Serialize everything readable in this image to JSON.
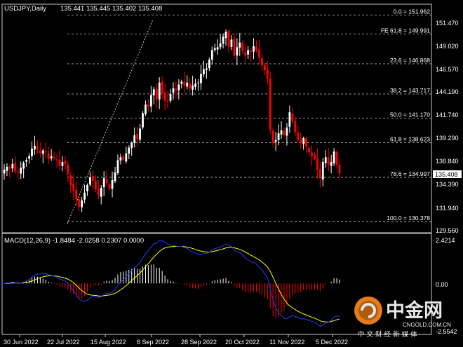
{
  "header": {
    "symbol": "USDJPY,Daily",
    "ohlc": "135.441 135.445 135.402 135.408"
  },
  "price_axis": {
    "labels": [
      "151.470",
      "149.020",
      "146.570",
      "144.190",
      "141.740",
      "139.290",
      "136.840",
      "134.390",
      "131.940",
      "129.560"
    ],
    "current_price": "135.408"
  },
  "fibonacci": {
    "levels": [
      {
        "label": "0.0 = 151.962",
        "price": 151.962
      },
      {
        "label": "FE 61.8 = 149.991",
        "price": 149.991
      },
      {
        "label": "23.6 = 146.868",
        "price": 146.868
      },
      {
        "label": "38.2 = 143.717",
        "price": 143.717
      },
      {
        "label": "50.0 = 141.170",
        "price": 141.17
      },
      {
        "label": "61.8 = 138.623",
        "price": 138.623
      },
      {
        "label": "78.6 = 134.997",
        "price": 134.997
      },
      {
        "label": "100.0 = 130.378",
        "price": 130.378
      }
    ]
  },
  "macd": {
    "title": "MACD(12,26,9) -1.8484 -2.0258 0.2307 0.0000",
    "axis_labels": [
      "2.4214",
      "0.00",
      "-2.5542"
    ]
  },
  "time_axis": {
    "labels": [
      "30 Jun 2022",
      "22 Jul 2022",
      "15 Aug 2022",
      "6 Sep 2022",
      "28 Sep 2022",
      "20 Oct 2022",
      "11 Nov 2022",
      "5 Dec 2022"
    ]
  },
  "watermark": {
    "brand": "中金网",
    "slogan": "中 文 财 经 新 媒 体",
    "url": "CNGOLD.COM.CN"
  },
  "colors": {
    "background": "#000000",
    "bull_candle": "#ffffff",
    "bear_candle": "#ff0000",
    "grid": "#c8c8c8",
    "macd_line": "#1f3dff",
    "signal_line": "#ffff00",
    "watermark_orange": "#ff8a1a"
  },
  "chart_data": {
    "type": "candlestick",
    "symbol": "USDJPY",
    "timeframe": "Daily",
    "y_range": [
      129.2,
      153.1
    ],
    "x_labels": [
      "30 Jun 2022",
      "22 Jul 2022",
      "15 Aug 2022",
      "6 Sep 2022",
      "28 Sep 2022",
      "20 Oct 2022",
      "11 Nov 2022",
      "5 Dec 2022"
    ],
    "close_path": [
      135.8,
      136.1,
      135.9,
      136.4,
      135.6,
      135.5,
      136.0,
      136.5,
      136.8,
      137.2,
      138.0,
      138.3,
      137.9,
      137.5,
      137.8,
      137.6,
      136.9,
      137.2,
      137.0,
      136.8,
      136.2,
      136.6,
      136.4,
      135.3,
      134.2,
      133.6,
      132.7,
      131.9,
      132.6,
      133.4,
      134.2,
      135.0,
      134.6,
      133.7,
      133.1,
      133.9,
      134.9,
      134.4,
      133.8,
      134.7,
      135.5,
      136.8,
      137.1,
      136.8,
      137.5,
      138.1,
      138.6,
      139.4,
      139.0,
      140.1,
      141.7,
      142.6,
      142.4,
      143.6,
      144.2,
      143.1,
      144.9,
      143.8,
      143.0,
      142.9,
      143.7,
      144.3,
      144.1,
      144.7,
      145.0,
      144.6,
      144.9,
      144.3,
      144.6,
      144.8,
      144.9,
      145.8,
      146.3,
      146.4,
      147.3,
      148.3,
      148.5,
      148.6,
      149.0,
      149.7,
      150.2,
      148.7,
      149.4,
      147.7,
      148.6,
      149.1,
      148.2,
      147.7,
      148.3,
      148.1,
      148.7,
      148.3,
      147.5,
      146.7,
      146.2,
      145.3,
      140.0,
      138.6,
      138.9,
      139.6,
      139.9,
      139.4,
      140.2,
      141.8,
      140.9,
      139.7,
      138.9,
      138.6,
      139.1,
      138.2,
      137.6,
      137.2,
      136.9,
      135.8,
      134.9,
      136.6,
      137.1,
      136.3,
      136.6,
      137.7,
      136.3,
      135.4
    ],
    "fibonacci_levels": [
      151.962,
      149.991,
      146.868,
      143.717,
      141.17,
      138.623,
      134.997,
      130.378
    ],
    "macd": {
      "params": [
        12,
        26,
        9
      ],
      "values": [
        -1.8484,
        -2.0258,
        0.2307,
        0.0
      ],
      "y_range": [
        -2.5542,
        2.4214
      ]
    }
  }
}
